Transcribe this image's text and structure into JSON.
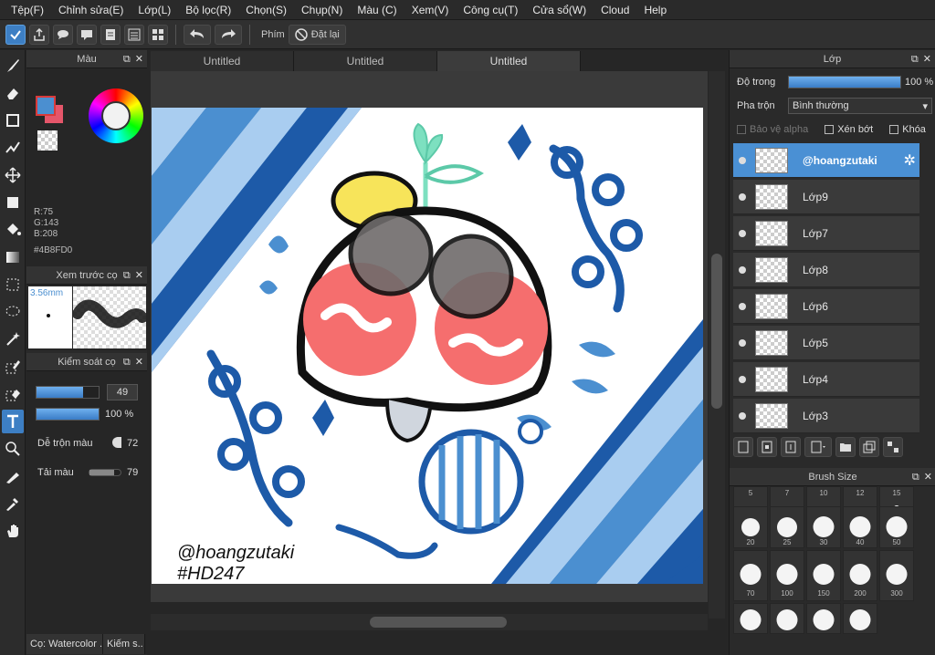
{
  "menu": [
    "Tệp(F)",
    "Chỉnh sửa(E)",
    "Lớp(L)",
    "Bộ lọc(R)",
    "Chọn(S)",
    "Chụp(N)",
    "Màu (C)",
    "Xem(V)",
    "Công cụ(T)",
    "Cửa sổ(W)",
    "Cloud",
    "Help"
  ],
  "toolbar": {
    "hotkey_label": "Phím",
    "reset_label": "Đặt lại"
  },
  "color_panel": {
    "title": "Màu",
    "r": "R:75",
    "g": "G:143",
    "b": "B:208",
    "hex": "#4B8FD0",
    "front_color": "#4b8fd0",
    "back_color": "#e5566a"
  },
  "preview_panel": {
    "title": "Xem trước cọ",
    "size": "3.56mm"
  },
  "brush_control": {
    "title": "Kiểm soát cọ",
    "size_value": "49",
    "opacity_value": "100 %",
    "blend_label": "Dễ trộn màu",
    "blend_value": "72",
    "load_label": "Tải màu",
    "load_value": "79",
    "tab_watercolor": "Cọ: Watercolor .",
    "tab_other": "Kiếm s.."
  },
  "documents": {
    "tabs": [
      "Untitled",
      "Untitled",
      "Untitled"
    ]
  },
  "canvas_text": {
    "signature": "@hoangzutaki",
    "tag": "#HD247"
  },
  "layer_panel": {
    "title": "Lớp",
    "opacity_label": "Độ trong",
    "opacity_value": "100 %",
    "blend_label": "Pha trộn",
    "blend_value": "Bình thường",
    "protect_alpha": "Bảo vệ alpha",
    "clip": "Xén bớt",
    "lock": "Khóa",
    "layers": [
      "@hoangzutaki",
      "Lớp9",
      "Lớp7",
      "Lớp8",
      "Lớp6",
      "Lớp5",
      "Lớp4",
      "Lớp3"
    ]
  },
  "brush_size_panel": {
    "title": "Brush Size",
    "sizes": [
      "5",
      "7",
      "10",
      "12",
      "15",
      "20",
      "25",
      "30",
      "40",
      "50",
      "70",
      "100",
      "150",
      "200",
      "300"
    ]
  }
}
